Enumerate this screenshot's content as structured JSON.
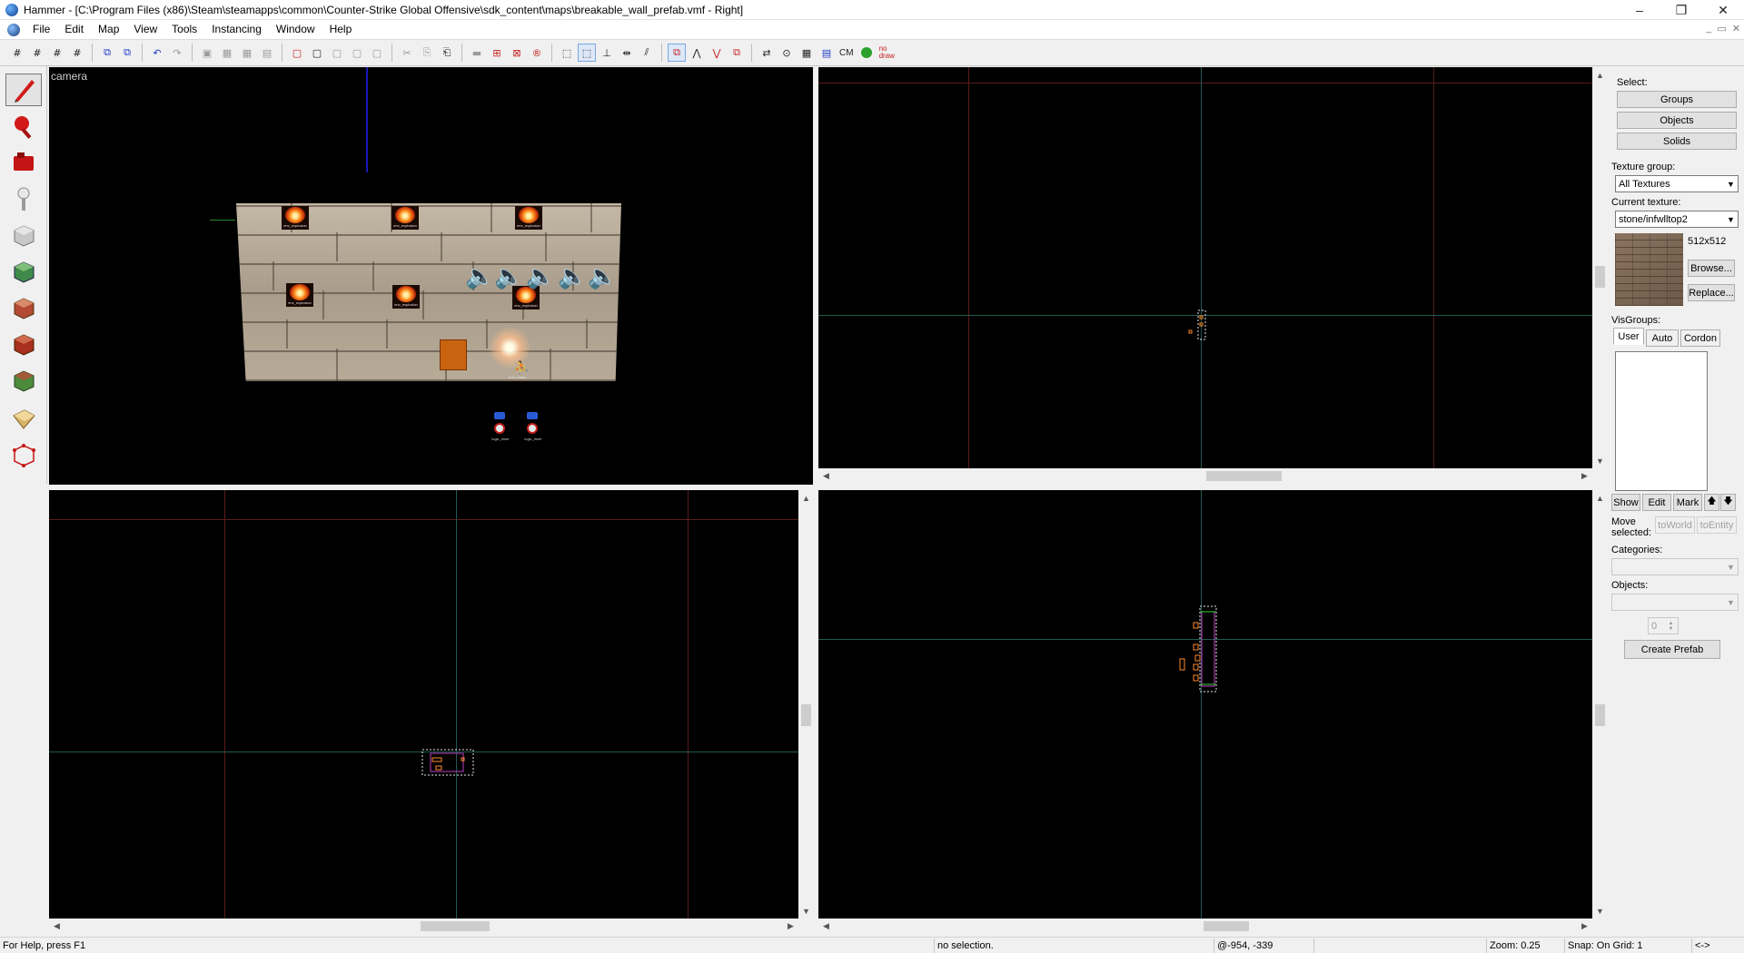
{
  "window": {
    "title": "Hammer - [C:\\Program Files (x86)\\Steam\\steamapps\\common\\Counter-Strike Global Offensive\\sdk_content\\maps\\breakable_wall_prefab.vmf - Right]",
    "controls": [
      "–",
      "❐",
      "✕"
    ]
  },
  "menu": {
    "items": [
      "File",
      "Edit",
      "Map",
      "View",
      "Tools",
      "Instancing",
      "Window",
      "Help"
    ],
    "mdi_controls": [
      "_",
      "▭",
      "✕"
    ]
  },
  "toolbar": {
    "groups": [
      [
        "#",
        "#",
        "#",
        "#"
      ],
      [
        "⧉",
        "⧉"
      ],
      [
        "↶",
        "↷"
      ],
      [
        "▣",
        "▦",
        "▦",
        "▤"
      ],
      [
        "▢",
        "▢",
        "▢",
        "▢",
        "▢"
      ],
      [
        "✂",
        "⎘",
        "⎗"
      ],
      [
        "▬",
        "⊞",
        "⊠",
        "®"
      ],
      [
        "⬚",
        "⬚",
        "⊥",
        "⇹",
        "⫽"
      ],
      [
        "⧉",
        "⋀",
        "⋁",
        "⧉"
      ],
      [
        "⇄",
        "⊙",
        "▦",
        "▤"
      ]
    ],
    "cm_label": "CM",
    "nodraw_label": "no draw"
  },
  "palette": {
    "tools": [
      "selection-tool",
      "magnify-tool",
      "camera-tool",
      "entity-tool",
      "block-tool",
      "texture-application-tool",
      "apply-current-texture-tool",
      "decal-tool",
      "overlay-tool",
      "clipping-tool",
      "vertex-tool"
    ]
  },
  "viewports": {
    "camera_label": "camera"
  },
  "camera_scene": {
    "entity_caption": "env_explosion",
    "timer_caption": "logic_timer",
    "shake_caption": "env_shake"
  },
  "panel": {
    "select_label": "Select:",
    "groups_button": "Groups",
    "objects_button": "Objects",
    "solids_button": "Solids",
    "texture_group_label": "Texture group:",
    "texture_group_value": "All Textures",
    "current_texture_label": "Current texture:",
    "current_texture_value": "stone/infwlltop2",
    "texture_size": "512x512",
    "browse_button": "Browse...",
    "replace_button": "Replace...",
    "visgroups_label": "VisGroups:",
    "tabs": [
      "User",
      "Auto",
      "Cordon"
    ],
    "show_button": "Show",
    "edit_button": "Edit",
    "mark_button": "Mark",
    "move_selected_label": "Move selected:",
    "toworld_button": "toWorld",
    "toentity_button": "toEntity",
    "categories_label": "Categories:",
    "objects_label": "Objects:",
    "objects_count": "0",
    "create_prefab_button": "Create Prefab"
  },
  "status": {
    "help": "For Help, press F1",
    "selection": "no selection.",
    "coords": "@-954, -339",
    "zoom": "Zoom: 0.25",
    "snap": "Snap: On Grid: 1",
    "extra": "<->"
  }
}
